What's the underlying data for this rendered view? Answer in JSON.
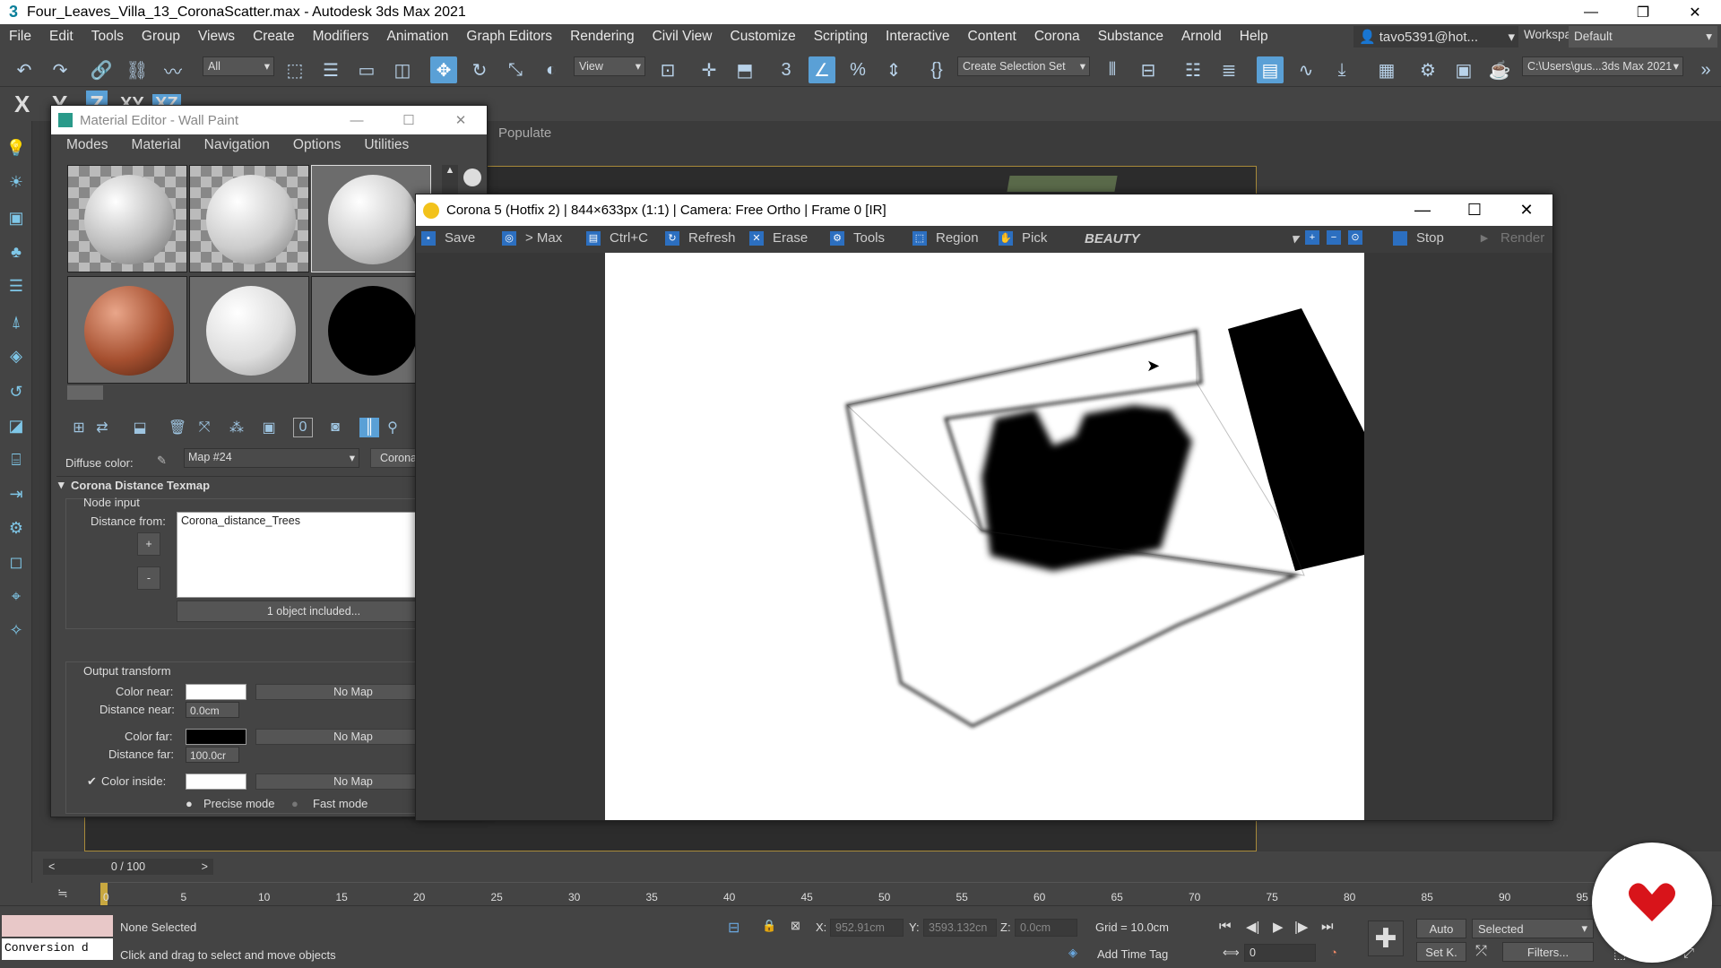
{
  "window": {
    "title": "Four_Leaves_Villa_13_CoronaScatter.max - Autodesk 3ds Max 2021",
    "app_icon": "3"
  },
  "menu": [
    "File",
    "Edit",
    "Tools",
    "Group",
    "Views",
    "Create",
    "Modifiers",
    "Animation",
    "Graph Editors",
    "Rendering",
    "Civil View",
    "Customize",
    "Scripting",
    "Interactive",
    "Content",
    "Corona",
    "Substance",
    "Arnold",
    "Help"
  ],
  "user": "tavo5391@hot...",
  "workspaces": {
    "label": "Workspaces:",
    "value": "Default"
  },
  "toolbar": {
    "filter": "All",
    "view": "View",
    "selection_set": "Create Selection Set",
    "path": "C:\\Users\\gus...3ds Max 2021"
  },
  "axes": [
    "X",
    "Y",
    "Z",
    "XY",
    "XZ"
  ],
  "populate": "Populate",
  "material_editor": {
    "title": "Material Editor - Wall Paint",
    "menu": [
      "Modes",
      "Material",
      "Navigation",
      "Options",
      "Utilities"
    ],
    "diffuse_label": "Diffuse color:",
    "map_name": "Map #24",
    "map_type": "Corona",
    "rollout_title": "Corona Distance Texmap",
    "node_input": "Node input",
    "distance_from": "Distance from:",
    "list_item": "Corona_distance_Trees",
    "plus": "+",
    "minus": "-",
    "objects_included": "1 object included...",
    "output_transform": "Output transform",
    "color_near": "Color near:",
    "distance_near": "Distance near:",
    "distance_near_value": "0.0cm",
    "color_far": "Color far:",
    "distance_far": "Distance far:",
    "distance_far_value": "100.0cr",
    "color_inside": "Color inside:",
    "no_map": "No Map",
    "precise_mode": "Precise mode",
    "fast_mode": "Fast mode",
    "colors": {
      "near": "#ffffff",
      "far": "#000000",
      "inside": "#ffffff"
    }
  },
  "corona": {
    "title": "Corona 5 (Hotfix 2) | 844×633px (1:1) | Camera: Free Ortho | Frame 0 [IR]",
    "buttons": [
      "Save",
      "> Max",
      "Ctrl+C",
      "Refresh",
      "Erase",
      "Tools",
      "Region",
      "Pick"
    ],
    "channel": "BEAUTY",
    "stop": "Stop",
    "render": "Render"
  },
  "timeline": {
    "frame_display": "0 / 100",
    "ticks": [
      "0",
      "5",
      "10",
      "15",
      "20",
      "25",
      "30",
      "35",
      "40",
      "45",
      "50",
      "55",
      "60",
      "65",
      "70",
      "75",
      "80",
      "85",
      "90",
      "95"
    ]
  },
  "status": {
    "conversion": "Conversion d",
    "none_selected": "None Selected",
    "hint": "Click and drag to select and move objects",
    "x_label": "X:",
    "x_value": "952.91cm",
    "y_label": "Y:",
    "y_value": "3593.132cn",
    "z_label": "Z:",
    "z_value": "0.0cm",
    "grid": "Grid = 10.0cm",
    "add_time_tag": "Add Time Tag",
    "auto": "Auto",
    "selected": "Selected",
    "set_key": "Set K.",
    "filters": "Filters...",
    "frame": "0"
  }
}
